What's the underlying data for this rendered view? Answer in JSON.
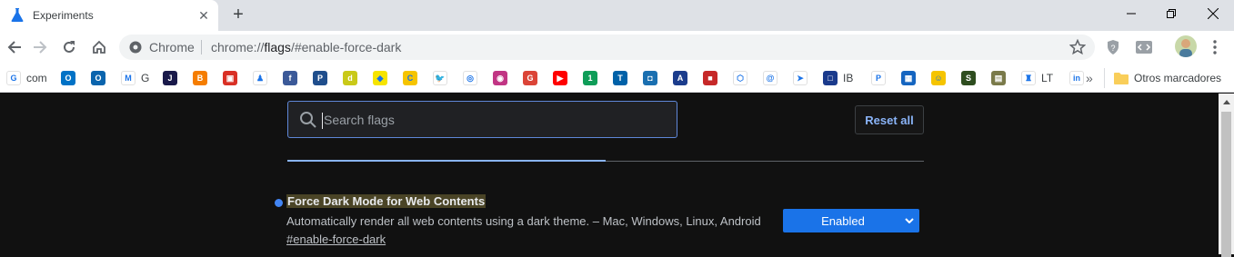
{
  "tab": {
    "title": "Experiments",
    "close": "✕",
    "newtab": "+"
  },
  "omnibox": {
    "scheme_label": "Chrome",
    "url_scheme": "chrome://",
    "url_host": "flags",
    "url_path": "/#enable-force-dark"
  },
  "bookmarks": [
    {
      "label": "com",
      "icon": "google-icon",
      "color": "#ffffff",
      "glyph": "G"
    },
    {
      "label": "",
      "icon": "outlook-icon",
      "color": "#0072c6",
      "glyph": "O"
    },
    {
      "label": "",
      "icon": "outlook-icon",
      "color": "#0a64ad",
      "glyph": "O"
    },
    {
      "label": "G",
      "icon": "gmail-icon",
      "color": "#ffffff",
      "glyph": "M"
    },
    {
      "label": "",
      "icon": "j-icon",
      "color": "#1a1a4a",
      "glyph": "J"
    },
    {
      "label": "",
      "icon": "blogger-icon",
      "color": "#f57d00",
      "glyph": "B"
    },
    {
      "label": "",
      "icon": "shop-icon",
      "color": "#d93025",
      "glyph": "▣"
    },
    {
      "label": "",
      "icon": "figure-icon",
      "color": "#ffffff",
      "glyph": "♟"
    },
    {
      "label": "",
      "icon": "facebook-icon",
      "color": "#3b5998",
      "glyph": "f"
    },
    {
      "label": "",
      "icon": "p21-icon",
      "color": "#1f4e8c",
      "glyph": "P"
    },
    {
      "label": "",
      "icon": "d-icon",
      "color": "#c9c918",
      "glyph": "d"
    },
    {
      "label": "",
      "icon": "badge-icon",
      "color": "#f6e400",
      "glyph": "◆"
    },
    {
      "label": "",
      "icon": "c-icon",
      "color": "#f5c400",
      "glyph": "C"
    },
    {
      "label": "",
      "icon": "twitter-icon",
      "color": "#ffffff",
      "glyph": "🐦"
    },
    {
      "label": "",
      "icon": "globe-icon",
      "color": "#ffffff",
      "glyph": "◎"
    },
    {
      "label": "",
      "icon": "instagram-icon",
      "color": "#c13584",
      "glyph": "◉"
    },
    {
      "label": "",
      "icon": "google-plus-icon",
      "color": "#db4437",
      "glyph": "G"
    },
    {
      "label": "",
      "icon": "youtube-icon",
      "color": "#ff0000",
      "glyph": "▶"
    },
    {
      "label": "",
      "icon": "one-icon",
      "color": "#0f9d58",
      "glyph": "1"
    },
    {
      "label": "",
      "icon": "t-icon",
      "color": "#0061a8",
      "glyph": "T"
    },
    {
      "label": "",
      "icon": "chat-icon",
      "color": "#1a6fb0",
      "glyph": "◘"
    },
    {
      "label": "",
      "icon": "a-plus-icon",
      "color": "#1b3c8c",
      "glyph": "A"
    },
    {
      "label": "",
      "icon": "box-icon",
      "color": "#c62828",
      "glyph": "■"
    },
    {
      "label": "",
      "icon": "cube-icon",
      "color": "#ffffff",
      "glyph": "⬡"
    },
    {
      "label": "",
      "icon": "swirl-icon",
      "color": "#ffffff",
      "glyph": "@"
    },
    {
      "label": "",
      "icon": "arrow-icon",
      "color": "#ffffff",
      "glyph": "➤"
    },
    {
      "label": "IB",
      "icon": "square-icon",
      "color": "#1a3a8c",
      "glyph": "□"
    },
    {
      "label": "",
      "icon": "paypal-icon",
      "color": "#ffffff",
      "glyph": "P"
    },
    {
      "label": "",
      "icon": "grid-icon",
      "color": "#1565c0",
      "glyph": "▦"
    },
    {
      "label": "",
      "icon": "face-icon",
      "color": "#f5c400",
      "glyph": "☺"
    },
    {
      "label": "",
      "icon": "s-icon",
      "color": "#2e4d1f",
      "glyph": "S"
    },
    {
      "label": "",
      "icon": "calc-icon",
      "color": "#7a7a4a",
      "glyph": "▤"
    },
    {
      "label": "LT",
      "icon": "robot-icon",
      "color": "#ffffff",
      "glyph": "♜"
    },
    {
      "label": "",
      "icon": "linkedin-icon",
      "color": "#ffffff",
      "glyph": "in"
    }
  ],
  "bookmarks_overflow": "»",
  "other_bookmarks": "Otros marcadores",
  "search": {
    "placeholder": "Search flags"
  },
  "reset_label": "Reset all",
  "flag": {
    "title": "Force Dark Mode for Web Contents",
    "description": "Automatically render all web contents using a dark theme. – Mac, Windows, Linux, Android",
    "link": "#enable-force-dark",
    "value": "Enabled"
  },
  "colors": {
    "accent": "#1a73e8",
    "dot": "#4285f4",
    "link_blue": "#8ab4f8"
  }
}
